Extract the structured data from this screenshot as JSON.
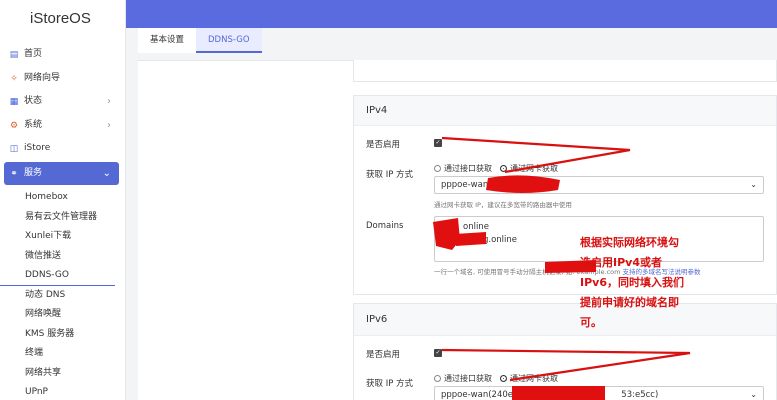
{
  "app": {
    "title": "iStoreOS"
  },
  "sidebar": {
    "items": [
      {
        "label": "首页",
        "icon": "dashboard-icon"
      },
      {
        "label": "网络向导",
        "icon": "wizard-icon"
      },
      {
        "label": "状态",
        "icon": "grid-icon",
        "chevron": true
      },
      {
        "label": "系统",
        "icon": "gear-icon",
        "chevron": true
      },
      {
        "label": "iStore",
        "icon": "store-icon"
      },
      {
        "label": "服务",
        "icon": "link-icon",
        "chevron": true,
        "active": true
      }
    ],
    "sub_items": [
      "Homebox",
      "易有云文件管理器",
      "Xunlei下载",
      "微信推送",
      "DDNS-GO",
      "动态 DNS",
      "网络唤醒",
      "KMS 服务器",
      "终端",
      "网络共享",
      "UPnP"
    ]
  },
  "tabs": [
    {
      "label": "基本设置"
    },
    {
      "label": "DDNS-GO",
      "active": true
    }
  ],
  "ipv4": {
    "title": "IPv4",
    "enable_label": "是否启用",
    "method_label": "获取 IP 方式",
    "option_interface": "通过接口获取",
    "option_nic": "通过网卡获取",
    "select_value": "pppoe-wan(",
    "select_hint": "通过网卡获取 IP，建议在多宽带的路由器中使用",
    "domains_label": "Domains",
    "domains_line1": "online",
    "domains_line2": "g.online",
    "domains_hint": "一行一个域名, 可使用冒号手动分隔主机记录, 如: ",
    "domains_hint_tail": "example.com",
    "domains_hint_link": "支持的多域名写法说明参数"
  },
  "ipv6": {
    "title": "IPv6",
    "enable_label": "是否启用",
    "method_label": "获取 IP 方式",
    "option_interface": "通过接口获取",
    "option_nic": "通过网卡获取",
    "select_value": "pppoe-wan(240e:3",
    "select_value_tail": "53:e5cc)"
  },
  "annotation": {
    "line1": "根据实际网络环境勾",
    "line2": "选启用IPv4或者",
    "line3": "IPv6，同时填入我们",
    "line4": "提前申请好的域名即",
    "line5": "可。"
  },
  "colors": {
    "accent": "#5469d4",
    "header": "#5a6adf",
    "annotation": "#d91010"
  }
}
